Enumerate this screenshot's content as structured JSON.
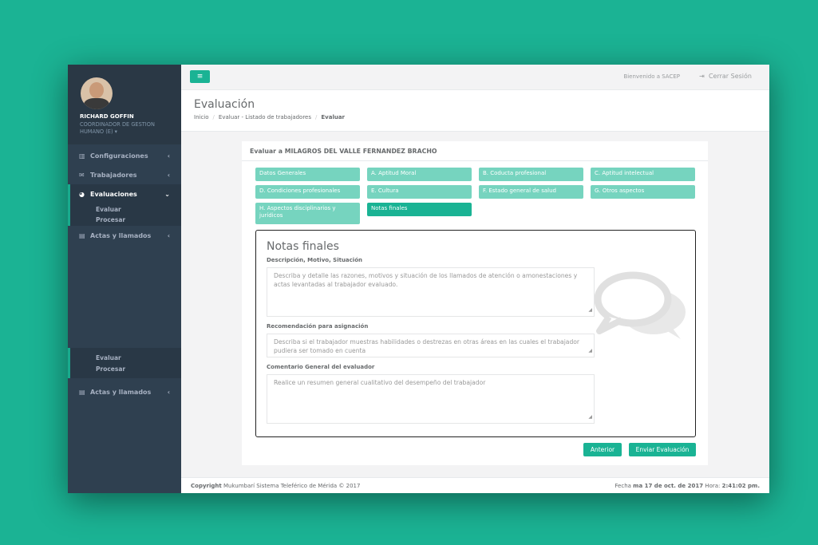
{
  "profile": {
    "name": "RICHARD GOFFIN",
    "role_line1": "COORDINADOR DE GESTION",
    "role_line2": "HUMANO (E) ▾"
  },
  "sidebar": {
    "items": [
      {
        "label": "Configuraciones",
        "icon": "chart-icon"
      },
      {
        "label": "Trabajadores",
        "icon": "envelope-icon"
      },
      {
        "label": "Evaluaciones",
        "icon": "pie-icon"
      },
      {
        "label": "Actas y llamados",
        "icon": "file-icon"
      }
    ],
    "sub": [
      "Evaluar",
      "Procesar"
    ],
    "sub2": [
      "Evaluar",
      "Procesar"
    ],
    "bottom_item": "Actas y llamados"
  },
  "topbar": {
    "menu": "≡",
    "welcome": "Bienvenido a SACEP",
    "logout": "Cerrar Sesión"
  },
  "page": {
    "title": "Evaluación",
    "crumb_home": "Inicio",
    "crumb_list": "Evaluar - Listado de trabajadores",
    "crumb_current": "Evaluar"
  },
  "box": {
    "title": "Evaluar a MILAGROS DEL VALLE FERNANDEZ BRACHO"
  },
  "tabs": [
    "Datos Generales",
    "A. Aptitud Moral",
    "B. Coducta profesional",
    "C. Aptitud intelectual",
    "D. Condiciones profesionales",
    "E. Cultura",
    "F. Estado general de salud",
    "G. Otros aspectos",
    "H. Aspectos disciplinarios y jurídicos",
    "Notas finales"
  ],
  "form": {
    "heading": "Notas finales",
    "label1": "Descripción, Motivo, Situación",
    "ph1": "Describa y detalle las razones, motivos y situación de los llamados de atención o amonestaciones y actas levantadas al trabajador evaluado.",
    "label2": "Recomendación para asignación",
    "ph2": "Describa si el trabajador muestras habilidades o destrezas en otras áreas en las cuales el trabajador pudiera ser tomado en cuenta",
    "label3": "Comentario General del evaluador",
    "ph3": "Realice un resumen general cualitativo del desempeño del trabajador"
  },
  "buttons": {
    "prev": "Anterior",
    "send": "Enviar Evaluación"
  },
  "footer": {
    "copy_bold": "Copyright",
    "copy": "Mukumbarí Sistema Teleférico de Mérida © 2017",
    "date_prefix": "Fecha",
    "date": "ma 17 de oct. de 2017",
    "time_prefix": "Hora:",
    "time": "2:41:02 pm."
  },
  "colors": {
    "accent": "#1ab394",
    "tab_light": "#76d4bf",
    "sidebar": "#2f4050"
  }
}
